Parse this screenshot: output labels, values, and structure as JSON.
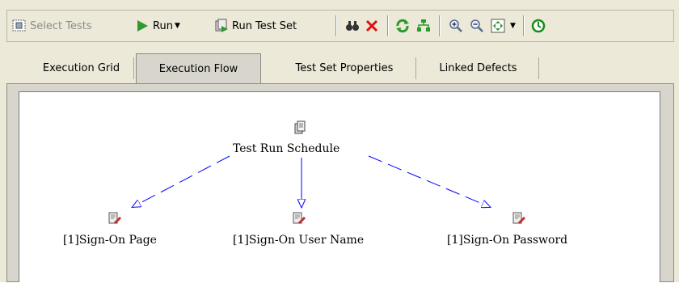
{
  "toolbar": {
    "select_tests_label": "Select Tests",
    "run_label": "Run",
    "run_test_set_label": "Run Test Set",
    "icons": [
      "select-tests-icon",
      "run-icon",
      "run-dropdown-icon",
      "run-test-set-icon",
      "find-icon",
      "delete-icon",
      "refresh-icon",
      "filter-icon",
      "zoom-in-icon",
      "zoom-out-icon",
      "fit-to-window-icon",
      "fit-dropdown-icon",
      "timer-icon"
    ]
  },
  "tabs": [
    {
      "label": "Execution Grid",
      "active": false
    },
    {
      "label": "Execution Flow",
      "active": true
    },
    {
      "label": "Test Set Properties",
      "active": false
    },
    {
      "label": "Linked Defects",
      "active": false
    }
  ],
  "flow": {
    "root": {
      "label": "Test Run Schedule",
      "icon": "test-set-icon"
    },
    "children": [
      {
        "label": "[1]Sign-On Page",
        "icon": "manual-test-icon"
      },
      {
        "label": "[1]Sign-On User Name",
        "icon": "manual-test-icon"
      },
      {
        "label": "[1]Sign-On Password",
        "icon": "manual-test-icon"
      }
    ],
    "connector_color": "#0000ff"
  }
}
